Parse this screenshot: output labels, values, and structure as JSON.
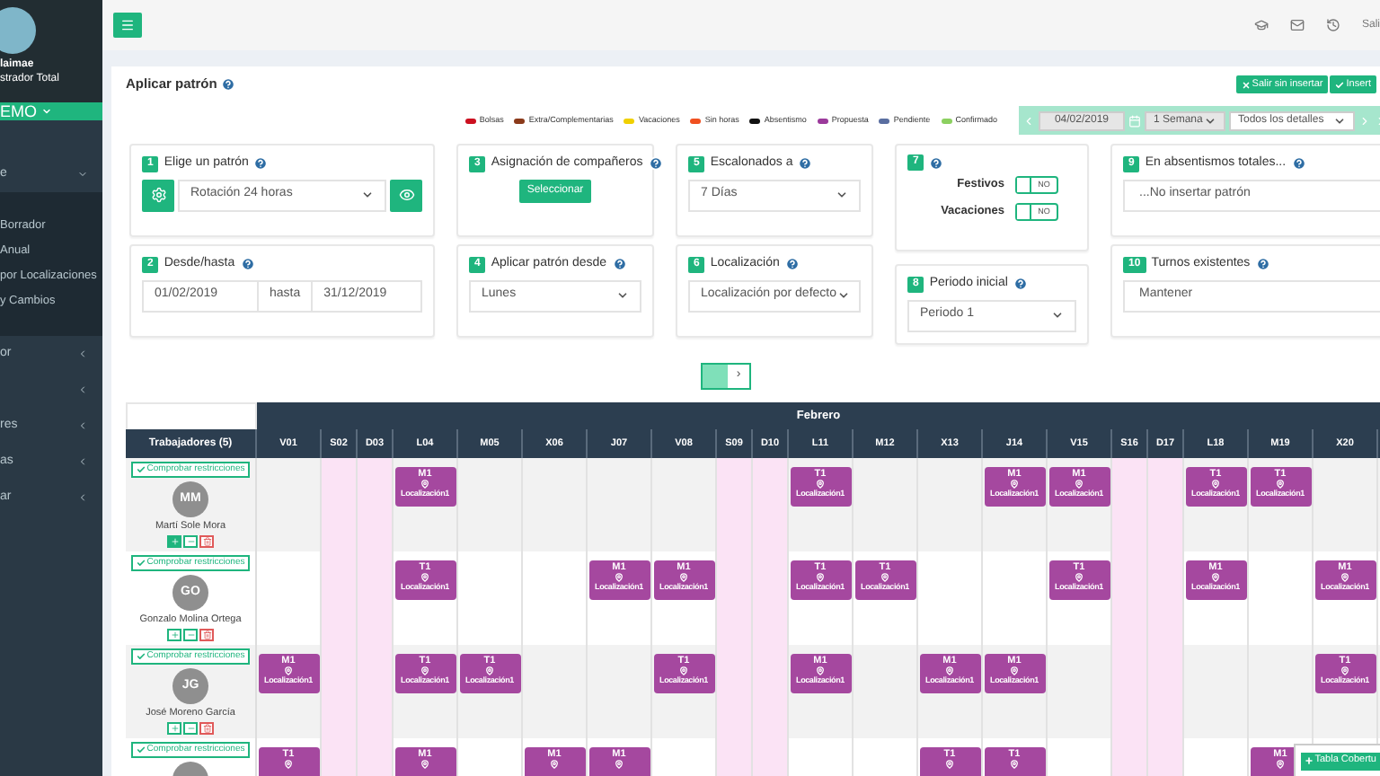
{
  "topbar": {
    "user": "Sali"
  },
  "sidebar": {
    "user_name": "laimae",
    "user_role": "strador Total",
    "company": "EMO",
    "items": [
      {
        "label": "e",
        "expanded": true,
        "children": [
          {
            "label": "Borrador"
          },
          {
            "label": "Anual"
          },
          {
            "label": "por Localizaciones"
          },
          {
            "label": "y Cambios"
          }
        ]
      },
      {
        "label": "or",
        "expanded": false
      },
      {
        "expanded": false
      },
      {
        "label": "res",
        "expanded": false
      },
      {
        "label": "as",
        "expanded": false
      },
      {
        "label": "ar",
        "expanded": false
      }
    ]
  },
  "page": {
    "title": "Aplicar patrón",
    "buttons": [
      {
        "label": "Salir sin insertar",
        "kind": "cancel"
      },
      {
        "label": "Insert",
        "kind": "confirm"
      }
    ]
  },
  "legend": [
    {
      "label": "Bolsas",
      "color": "#cc1020"
    },
    {
      "label": "Extra/Complementarias",
      "color": "#8b3a1a"
    },
    {
      "label": "Vacaciones",
      "color": "#f0d000"
    },
    {
      "label": "Sin horas",
      "color": "#f05020"
    },
    {
      "label": "Absentismo",
      "color": "#111111"
    },
    {
      "label": "Propuesta",
      "color": "#9b3a9b"
    },
    {
      "label": "Pendiente",
      "color": "#5a6ea0"
    },
    {
      "label": "Confirmado",
      "color": "#8cd060"
    }
  ],
  "date_nav": {
    "date": "04/02/2019",
    "range": "1 Semana",
    "detail": "Todos los detalles"
  },
  "step_columns": [
    [
      {
        "number": "1",
        "title": "Elige un patrón",
        "kind": "pattern",
        "value": "Rotación 24 horas"
      },
      {
        "number": "2",
        "title": "Desde/hasta",
        "kind": "range",
        "from": "01/02/2019",
        "separator": "hasta",
        "to": "31/12/2019"
      }
    ],
    [
      {
        "number": "3",
        "title": "Asignación de compañeros",
        "kind": "button",
        "value": "Seleccionar"
      },
      {
        "number": "4",
        "title": "Aplicar patrón desde",
        "kind": "select",
        "value": "Lunes"
      }
    ],
    [
      {
        "number": "5",
        "title": "Escalonados a",
        "kind": "select",
        "value": "7 Días"
      },
      {
        "number": "6",
        "title": "Localización",
        "kind": "select",
        "value": "Localización por defecto"
      }
    ],
    [
      {
        "number": "7",
        "kind": "toggles",
        "toggles": [
          {
            "label": "Festivos",
            "on": false,
            "state": "NO"
          },
          {
            "label": "Vacaciones",
            "on": false,
            "state": "NO"
          }
        ]
      },
      {
        "number": "8",
        "title": "Periodo inicial",
        "kind": "select",
        "value": "Periodo 1"
      }
    ],
    [
      {
        "number": "9",
        "title": "En absentismos totales...",
        "kind": "field",
        "value": "...No insertar patrón"
      },
      {
        "number": "10",
        "title": "Turnos existentes",
        "kind": "field",
        "value": "Mantener"
      }
    ]
  ],
  "pager": [
    {
      "kind": "page",
      "selected": true
    },
    {
      "kind": "next",
      "label": "›",
      "selected": false
    }
  ],
  "schedule": {
    "month": "Febrero",
    "worker_header": "Trabajadores (5)",
    "days": [
      {
        "label": "V01",
        "weekend": false
      },
      {
        "label": "S02",
        "weekend": true
      },
      {
        "label": "D03",
        "weekend": true
      },
      {
        "label": "L04",
        "weekend": false
      },
      {
        "label": "M05",
        "weekend": false
      },
      {
        "label": "X06",
        "weekend": false
      },
      {
        "label": "J07",
        "weekend": false
      },
      {
        "label": "V08",
        "weekend": false
      },
      {
        "label": "S09",
        "weekend": true
      },
      {
        "label": "D10",
        "weekend": true
      },
      {
        "label": "L11",
        "weekend": false
      },
      {
        "label": "M12",
        "weekend": false
      },
      {
        "label": "X13",
        "weekend": false
      },
      {
        "label": "J14",
        "weekend": false
      },
      {
        "label": "V15",
        "weekend": false
      },
      {
        "label": "S16",
        "weekend": true
      },
      {
        "label": "D17",
        "weekend": true
      },
      {
        "label": "L18",
        "weekend": false
      },
      {
        "label": "M19",
        "weekend": false
      },
      {
        "label": "X20",
        "weekend": false
      }
    ],
    "rows": [
      {
        "check": "Comprobar restricciones",
        "initials": "MM",
        "name": "Martí Sole Mora",
        "add_on": true,
        "cells": [
          null,
          null,
          null,
          {
            "shift": "M1",
            "place": "Localización1"
          },
          null,
          null,
          null,
          null,
          null,
          null,
          {
            "shift": "T1",
            "place": "Localización1"
          },
          null,
          null,
          {
            "shift": "M1",
            "place": "Localización1"
          },
          {
            "shift": "M1",
            "place": "Localización1"
          },
          null,
          null,
          {
            "shift": "T1",
            "place": "Localización1"
          },
          {
            "shift": "T1",
            "place": "Localización1"
          },
          null
        ]
      },
      {
        "check": "Comprobar restricciones",
        "initials": "GO",
        "name": "Gonzalo Molina Ortega",
        "add_on": false,
        "cells": [
          null,
          null,
          null,
          {
            "shift": "T1",
            "place": "Localización1"
          },
          null,
          null,
          {
            "shift": "M1",
            "place": "Localización1"
          },
          {
            "shift": "M1",
            "place": "Localización1"
          },
          null,
          null,
          {
            "shift": "T1",
            "place": "Localización1"
          },
          {
            "shift": "T1",
            "place": "Localización1"
          },
          null,
          null,
          {
            "shift": "T1",
            "place": "Localización1"
          },
          null,
          null,
          {
            "shift": "M1",
            "place": "Localización1"
          },
          null,
          {
            "shift": "M1",
            "place": "Localización1"
          }
        ]
      },
      {
        "check": "Comprobar restricciones",
        "initials": "JG",
        "name": "José Moreno García",
        "add_on": false,
        "cells": [
          {
            "shift": "M1",
            "place": "Localización1"
          },
          null,
          null,
          {
            "shift": "T1",
            "place": "Localización1"
          },
          {
            "shift": "T1",
            "place": "Localización1"
          },
          null,
          null,
          {
            "shift": "T1",
            "place": "Localización1"
          },
          null,
          null,
          {
            "shift": "M1",
            "place": "Localización1"
          },
          null,
          {
            "shift": "M1",
            "place": "Localización1"
          },
          {
            "shift": "M1",
            "place": "Localización1"
          },
          null,
          null,
          null,
          null,
          null,
          {
            "shift": "T1",
            "place": "Localización1"
          }
        ]
      },
      {
        "check": "Comprobar restricciones",
        "cells": [
          {
            "shift": "T1"
          },
          null,
          null,
          {
            "shift": "M1"
          },
          null,
          {
            "shift": "M1"
          },
          {
            "shift": "M1"
          },
          null,
          null,
          null,
          null,
          null,
          {
            "shift": "T1"
          },
          {
            "shift": "T1"
          },
          null,
          null,
          null,
          null,
          {
            "shift": "M1"
          },
          null
        ]
      }
    ]
  },
  "coverage_button": {
    "label": "Tabla Cobertu"
  }
}
